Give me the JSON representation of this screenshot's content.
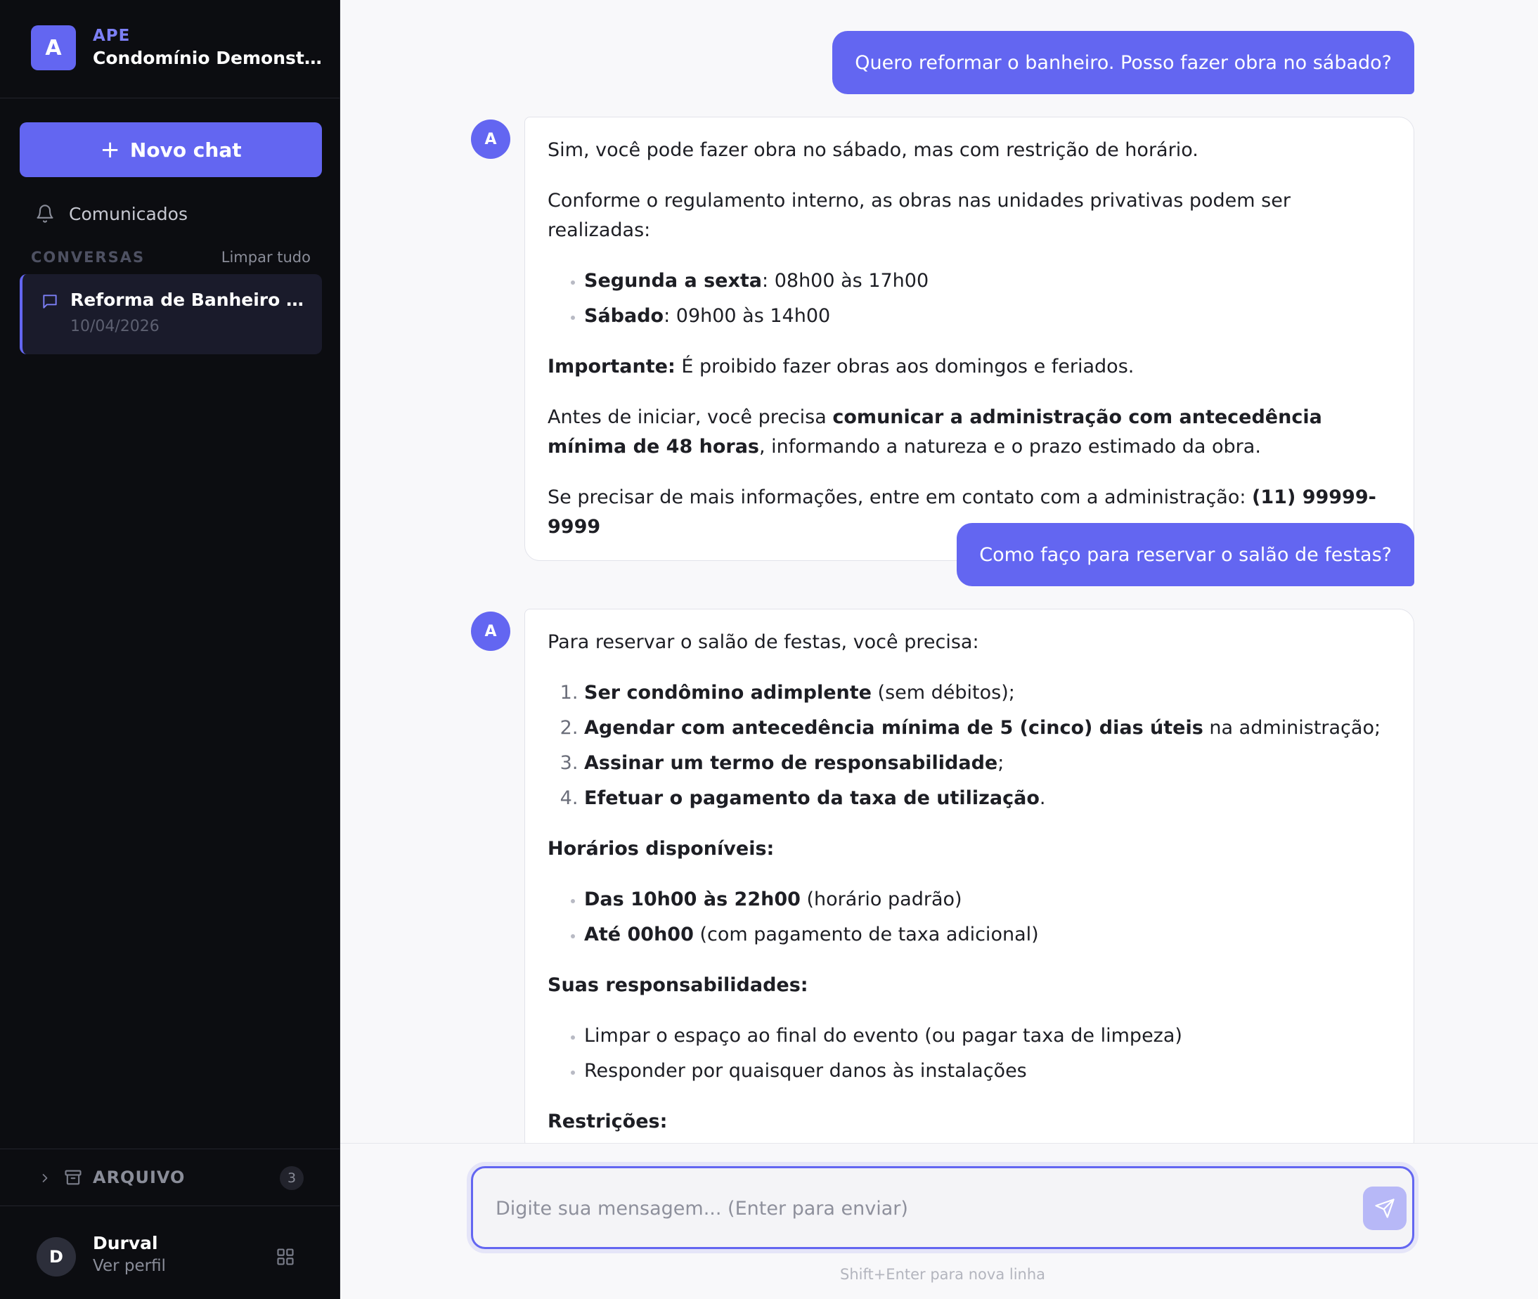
{
  "sidebar": {
    "brand": {
      "logo_letter": "A",
      "tag": "APE",
      "name": "Condomínio Demonstração"
    },
    "new_chat_label": "Novo chat",
    "nav": {
      "announcements": "Comunicados"
    },
    "conversations_title": "CONVERSAS",
    "clear_all": "Limpar tudo",
    "conversations": [
      {
        "title": "Reforma de Banheiro no Sábado",
        "date": "10/04/2026"
      }
    ],
    "archive": {
      "label": "ARQUIVO",
      "count": "3"
    },
    "profile": {
      "initial": "D",
      "name": "Durval",
      "link": "Ver perfil"
    }
  },
  "chat": {
    "bot_initial": "A",
    "messages": [
      {
        "role": "user",
        "text": "Quero reformar o banheiro. Posso fazer obra no sábado?"
      },
      {
        "role": "assistant",
        "p1": "Sim, você pode fazer obra no sábado, mas com restrição de horário.",
        "p2": "Conforme o regulamento interno, as obras nas unidades privativas podem ser realizadas:",
        "hours": [
          {
            "day": "Segunda a sexta",
            "time": ": 08h00 às 17h00"
          },
          {
            "day": "Sábado",
            "time": ": 09h00 às 14h00"
          }
        ],
        "important_label": "Importante:",
        "important_text": " É proibido fazer obras aos domingos e feriados.",
        "notice_pre": "Antes de iniciar, você precisa ",
        "notice_bold": "comunicar a administração com antecedência mínima de 48 horas",
        "notice_post": ", informando a natureza e o prazo estimado da obra.",
        "contact_pre": "Se precisar de mais informações, entre em contato com a administração: ",
        "contact_phone": "(11) 99999-9999"
      },
      {
        "role": "user",
        "text": "Como faço para reservar o salão de festas?"
      },
      {
        "role": "assistant",
        "intro": "Para reservar o salão de festas, você precisa:",
        "steps": [
          {
            "bold": "Ser condômino adimplente",
            "rest": " (sem débitos);"
          },
          {
            "bold": "Agendar com antecedência mínima de 5 (cinco) dias úteis",
            "rest": " na administração;"
          },
          {
            "bold": "Assinar um termo de responsabilidade",
            "rest": ";"
          },
          {
            "bold": "Efetuar o pagamento da taxa de utilização",
            "rest": "."
          }
        ],
        "hours_title": "Horários disponíveis:",
        "hours": [
          {
            "bold": "Das 10h00 às 22h00",
            "rest": " (horário padrão)"
          },
          {
            "bold": "Até 00h00",
            "rest": " (com pagamento de taxa adicional)"
          }
        ],
        "resp_title": "Suas responsabilidades:",
        "resp": [
          "Limpar o espaço ao final do evento (ou pagar taxa de limpeza)",
          "Responder por quaisquer danos às instalações"
        ],
        "restr_title": "Restrições:"
      }
    ]
  },
  "composer": {
    "placeholder": "Digite sua mensagem... (Enter para enviar)",
    "hint": "Shift+Enter para nova linha"
  },
  "colors": {
    "accent": "#6366f1",
    "sidebar_bg": "#0c0d11",
    "chat_bg": "#f8f8fa"
  }
}
